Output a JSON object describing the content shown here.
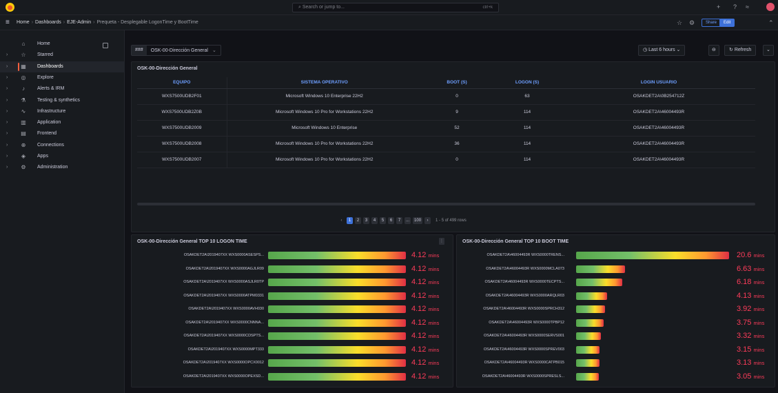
{
  "topbar": {
    "search_placeholder": "Search or jump to...",
    "search_kbd": "ctrl+k"
  },
  "breadcrumb": {
    "home": "Home",
    "dashboards": "Dashboards",
    "folder": "EJE-Admin",
    "current": "Prequeta - Desplegable LogonTime y BootTime"
  },
  "actions": {
    "share": "Share",
    "edit": "Edit"
  },
  "sidebar": {
    "items": [
      {
        "label": "Home",
        "icon": "home-icon"
      },
      {
        "label": "Starred",
        "icon": "star-icon"
      },
      {
        "label": "Dashboards",
        "icon": "dashboards-icon"
      },
      {
        "label": "Explore",
        "icon": "explore-icon"
      },
      {
        "label": "Alerts & IRM",
        "icon": "bell-icon"
      },
      {
        "label": "Testing & synthetics",
        "icon": "testing-icon"
      },
      {
        "label": "Infrastructure",
        "icon": "infrastructure-icon"
      },
      {
        "label": "Application",
        "icon": "application-icon"
      },
      {
        "label": "Frontend",
        "icon": "frontend-icon"
      },
      {
        "label": "Connections",
        "icon": "connections-icon"
      },
      {
        "label": "Apps",
        "icon": "apps-icon"
      },
      {
        "label": "Administration",
        "icon": "gear-icon"
      }
    ]
  },
  "controls": {
    "var_label": "###",
    "var_value": "OSK-00-Dirección General",
    "time_range": "Last 6 hours",
    "refresh": "Refresh"
  },
  "table_panel": {
    "title": "OSK-00-Dirección General",
    "columns": [
      "EQUIPO",
      "SISTEMA OPERATIVO",
      "BOOT (S)",
      "LOGON (S)",
      "LOGIN USUARIO"
    ],
    "rows": [
      [
        "WXS7500UDB2F01",
        "Microsoft Windows 10 Enterprise 22H2",
        "0",
        "63",
        "OSAKDET2A\\0B254712Z"
      ],
      [
        "WXS7500UDB2Z0B",
        "Microsoft Windows 10 Pro for Workstations 22H2",
        "9",
        "114",
        "OSAKDET2A\\46004493R"
      ],
      [
        "WXS7500UDB2009",
        "Microsoft Windows 10 Enterprise",
        "52",
        "114",
        "OSAKDET2A\\46004493R"
      ],
      [
        "WXS7500UDB2008",
        "Microsoft Windows 10 Pro for Workstations 22H2",
        "36",
        "114",
        "OSAKDET2A\\46004493R"
      ],
      [
        "WXS7500UDB2007",
        "Microsoft Windows 10 Pro for Workstations 22H2",
        "0",
        "114",
        "OSAKDET2A\\46004493R"
      ]
    ],
    "pages": [
      "1",
      "2",
      "3",
      "4",
      "5",
      "6",
      "7",
      "...",
      "100"
    ],
    "page_info": "1 - 5 of 499 rows"
  },
  "logon_panel": {
    "title": "OSK-00-Dirección General TOP 10 LOGON TIME",
    "menu": "⋮",
    "unit": "mins",
    "max": 4.12,
    "items": [
      {
        "label": "OSAKDET2A\\2019407XX WXS0000ASESPS...",
        "value": 4.12,
        "display": "4.12"
      },
      {
        "label": "OSAKDET2A\\2019407XX WXS0000AGJLR09",
        "value": 4.12,
        "display": "4.12"
      },
      {
        "label": "OSAKDET2A\\2019407XX WXS0000ASJLR0TP",
        "value": 4.12,
        "display": "4.12"
      },
      {
        "label": "OSAKDET2A\\2019407XX WXS0000ATPM0331",
        "value": 4.12,
        "display": "4.12"
      },
      {
        "label": "OSAKDET2A\\2019407XX WXS0000AVH030",
        "value": 4.12,
        "display": "4.12"
      },
      {
        "label": "OSAKDET2A\\2019407XX WXS0000CNNNA...",
        "value": 4.12,
        "display": "4.12"
      },
      {
        "label": "OSAKDET2A\\2019407XX WXS0000CDSPTS...",
        "value": 4.12,
        "display": "4.12"
      },
      {
        "label": "OSAKDET2A\\2019407XX WXS0000MPT333",
        "value": 4.12,
        "display": "4.12"
      },
      {
        "label": "OSAKDET2A\\2019407XX WXS0000OPCX0012",
        "value": 4.12,
        "display": "4.12"
      },
      {
        "label": "OSAKDET2A\\2019407XX WXS0000OPEXSD...",
        "value": 4.12,
        "display": "4.12"
      }
    ]
  },
  "boot_panel": {
    "title": "OSK-00-Dirección General TOP 10 BOOT TIME",
    "unit": "mins",
    "max": 20.6,
    "items": [
      {
        "label": "OSAKDET2A\\46004493R WXS0000TRENS...",
        "value": 20.6,
        "display": "20.6"
      },
      {
        "label": "OSAKDET2A\\46004493R WXS0000MCLA073",
        "value": 6.63,
        "display": "6.63"
      },
      {
        "label": "OSAKDET2A\\46004493R WXS0000TECPTS...",
        "value": 6.18,
        "display": "6.18"
      },
      {
        "label": "OSAKDET2A\\46004493R WXS0000ARQLR03",
        "value": 4.13,
        "display": "4.13"
      },
      {
        "label": "OSAKDET2A\\46004493R WXS0000SPRCH312",
        "value": 3.92,
        "display": "3.92"
      },
      {
        "label": "OSAKDET2A\\46004493R WXS0000TPBP12",
        "value": 3.75,
        "display": "3.75"
      },
      {
        "label": "OSAKDET2A\\46004493R WXS0000SERVS001",
        "value": 3.32,
        "display": "3.32"
      },
      {
        "label": "OSAKDET2A\\46004493R WXS0000SPREV003",
        "value": 3.15,
        "display": "3.15"
      },
      {
        "label": "OSAKDET2A\\46004493R WXS0000CATPB015",
        "value": 3.13,
        "display": "3.13"
      },
      {
        "label": "OSAKDET2A\\46004493R WXS0000SPRESLS...",
        "value": 3.05,
        "display": "3.05"
      }
    ]
  }
}
